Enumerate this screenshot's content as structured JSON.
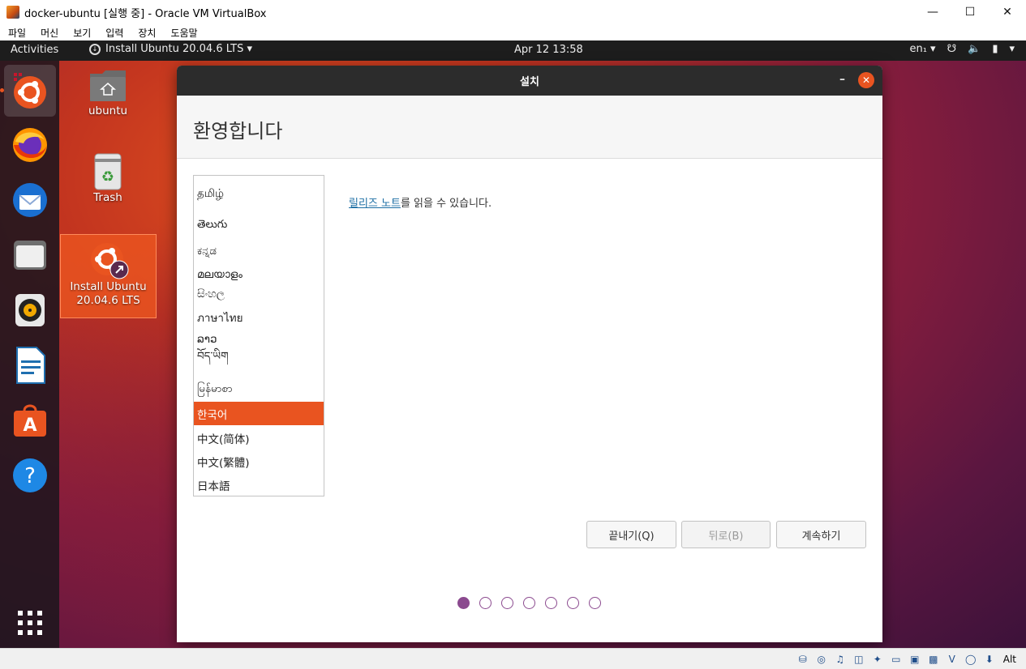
{
  "host": {
    "title": "docker-ubuntu [실행 중] - Oracle VM VirtualBox",
    "menu": [
      "파일",
      "머신",
      "보기",
      "입력",
      "장치",
      "도움말"
    ],
    "status_right": "Alt"
  },
  "topbar": {
    "activities": "Activities",
    "app_name": "Install Ubuntu 20.04.6 LTS ▾",
    "clock": "Apr 12  13:58",
    "keyboard": "en₁ ▾"
  },
  "desktop": {
    "home_label": "ubuntu",
    "trash_label": "Trash",
    "install_label_1": "Install Ubuntu",
    "install_label_2": "20.04.6 LTS"
  },
  "installer": {
    "window_title": "설치",
    "heading": "환영합니다",
    "languages": [
      "தமிழ்",
      "తెలుగు",
      "ಕನ್ನಡ",
      "മലയാളം",
      "සිංහල",
      "ภาษาไทย",
      "ລາວ",
      "བོད་ཡིག",
      "မြန်မာစာ",
      "한국어",
      "中文(简体)",
      "中文(繁體)",
      "日本語"
    ],
    "selected_language": "한국어",
    "release_link": "릴리즈 노트",
    "release_suffix": "를 읽을 수 있습니다.",
    "quit_button": "끝내기(Q)",
    "back_button": "뒤로(B)",
    "continue_button": "계속하기",
    "step_current": 1,
    "step_total": 7
  },
  "colors": {
    "accent": "#e95420",
    "step_dot": "#8b4a8f",
    "link": "#1c6ea4"
  }
}
